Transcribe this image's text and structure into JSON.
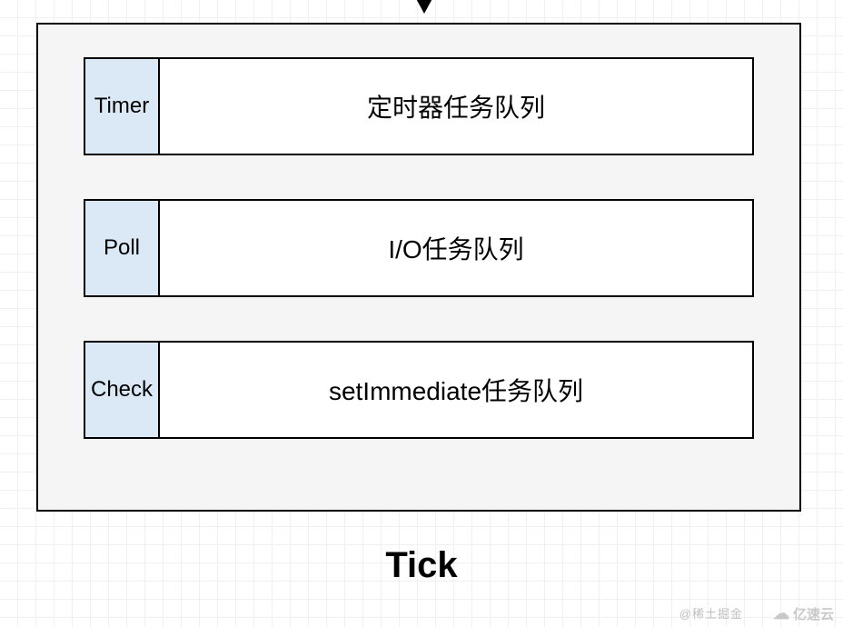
{
  "rows": [
    {
      "label": "Timer",
      "queue": "定时器任务队列"
    },
    {
      "label": "Poll",
      "queue": "I/O任务队列"
    },
    {
      "label": "Check",
      "queue": "setImmediate任务队列"
    }
  ],
  "tick": "Tick",
  "watermark1": "@稀土掘金",
  "watermark2": "亿速云"
}
